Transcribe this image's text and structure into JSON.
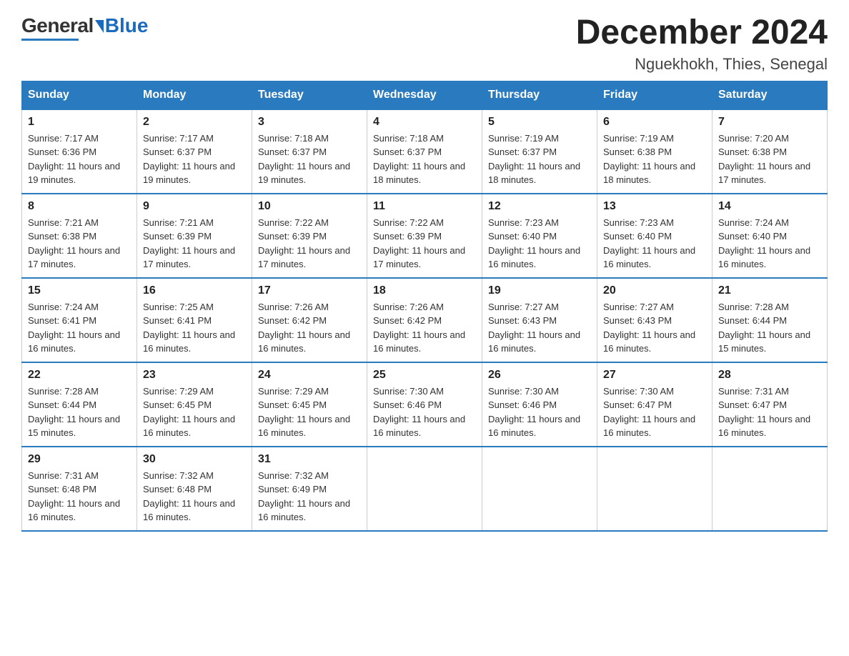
{
  "header": {
    "logo": {
      "general": "General",
      "blue": "Blue"
    },
    "title": "December 2024",
    "location": "Nguekhokh, Thies, Senegal"
  },
  "days_of_week": [
    "Sunday",
    "Monday",
    "Tuesday",
    "Wednesday",
    "Thursday",
    "Friday",
    "Saturday"
  ],
  "weeks": [
    [
      {
        "day": "1",
        "sunrise": "7:17 AM",
        "sunset": "6:36 PM",
        "daylight": "11 hours and 19 minutes."
      },
      {
        "day": "2",
        "sunrise": "7:17 AM",
        "sunset": "6:37 PM",
        "daylight": "11 hours and 19 minutes."
      },
      {
        "day": "3",
        "sunrise": "7:18 AM",
        "sunset": "6:37 PM",
        "daylight": "11 hours and 19 minutes."
      },
      {
        "day": "4",
        "sunrise": "7:18 AM",
        "sunset": "6:37 PM",
        "daylight": "11 hours and 18 minutes."
      },
      {
        "day": "5",
        "sunrise": "7:19 AM",
        "sunset": "6:37 PM",
        "daylight": "11 hours and 18 minutes."
      },
      {
        "day": "6",
        "sunrise": "7:19 AM",
        "sunset": "6:38 PM",
        "daylight": "11 hours and 18 minutes."
      },
      {
        "day": "7",
        "sunrise": "7:20 AM",
        "sunset": "6:38 PM",
        "daylight": "11 hours and 17 minutes."
      }
    ],
    [
      {
        "day": "8",
        "sunrise": "7:21 AM",
        "sunset": "6:38 PM",
        "daylight": "11 hours and 17 minutes."
      },
      {
        "day": "9",
        "sunrise": "7:21 AM",
        "sunset": "6:39 PM",
        "daylight": "11 hours and 17 minutes."
      },
      {
        "day": "10",
        "sunrise": "7:22 AM",
        "sunset": "6:39 PM",
        "daylight": "11 hours and 17 minutes."
      },
      {
        "day": "11",
        "sunrise": "7:22 AM",
        "sunset": "6:39 PM",
        "daylight": "11 hours and 17 minutes."
      },
      {
        "day": "12",
        "sunrise": "7:23 AM",
        "sunset": "6:40 PM",
        "daylight": "11 hours and 16 minutes."
      },
      {
        "day": "13",
        "sunrise": "7:23 AM",
        "sunset": "6:40 PM",
        "daylight": "11 hours and 16 minutes."
      },
      {
        "day": "14",
        "sunrise": "7:24 AM",
        "sunset": "6:40 PM",
        "daylight": "11 hours and 16 minutes."
      }
    ],
    [
      {
        "day": "15",
        "sunrise": "7:24 AM",
        "sunset": "6:41 PM",
        "daylight": "11 hours and 16 minutes."
      },
      {
        "day": "16",
        "sunrise": "7:25 AM",
        "sunset": "6:41 PM",
        "daylight": "11 hours and 16 minutes."
      },
      {
        "day": "17",
        "sunrise": "7:26 AM",
        "sunset": "6:42 PM",
        "daylight": "11 hours and 16 minutes."
      },
      {
        "day": "18",
        "sunrise": "7:26 AM",
        "sunset": "6:42 PM",
        "daylight": "11 hours and 16 minutes."
      },
      {
        "day": "19",
        "sunrise": "7:27 AM",
        "sunset": "6:43 PM",
        "daylight": "11 hours and 16 minutes."
      },
      {
        "day": "20",
        "sunrise": "7:27 AM",
        "sunset": "6:43 PM",
        "daylight": "11 hours and 16 minutes."
      },
      {
        "day": "21",
        "sunrise": "7:28 AM",
        "sunset": "6:44 PM",
        "daylight": "11 hours and 15 minutes."
      }
    ],
    [
      {
        "day": "22",
        "sunrise": "7:28 AM",
        "sunset": "6:44 PM",
        "daylight": "11 hours and 15 minutes."
      },
      {
        "day": "23",
        "sunrise": "7:29 AM",
        "sunset": "6:45 PM",
        "daylight": "11 hours and 16 minutes."
      },
      {
        "day": "24",
        "sunrise": "7:29 AM",
        "sunset": "6:45 PM",
        "daylight": "11 hours and 16 minutes."
      },
      {
        "day": "25",
        "sunrise": "7:30 AM",
        "sunset": "6:46 PM",
        "daylight": "11 hours and 16 minutes."
      },
      {
        "day": "26",
        "sunrise": "7:30 AM",
        "sunset": "6:46 PM",
        "daylight": "11 hours and 16 minutes."
      },
      {
        "day": "27",
        "sunrise": "7:30 AM",
        "sunset": "6:47 PM",
        "daylight": "11 hours and 16 minutes."
      },
      {
        "day": "28",
        "sunrise": "7:31 AM",
        "sunset": "6:47 PM",
        "daylight": "11 hours and 16 minutes."
      }
    ],
    [
      {
        "day": "29",
        "sunrise": "7:31 AM",
        "sunset": "6:48 PM",
        "daylight": "11 hours and 16 minutes."
      },
      {
        "day": "30",
        "sunrise": "7:32 AM",
        "sunset": "6:48 PM",
        "daylight": "11 hours and 16 minutes."
      },
      {
        "day": "31",
        "sunrise": "7:32 AM",
        "sunset": "6:49 PM",
        "daylight": "11 hours and 16 minutes."
      },
      null,
      null,
      null,
      null
    ]
  ]
}
